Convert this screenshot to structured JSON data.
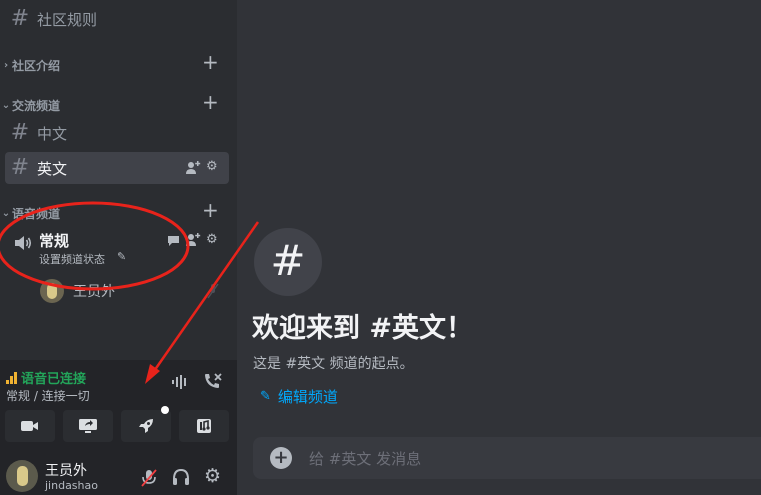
{
  "sidebar": {
    "top_channel": "社区规则",
    "categories": {
      "intro": "社区介绍",
      "text": "交流频道",
      "voice": "语音频道"
    },
    "channels": [
      "中文",
      "英文"
    ],
    "voice_channel": {
      "name": "常规",
      "status": "设置频道状态",
      "member": "王员外"
    }
  },
  "voice_panel": {
    "connected": "语音已连接",
    "location": "常规 / 连接一切"
  },
  "user_panel": {
    "name": "王员外",
    "handle": "jindashao"
  },
  "main": {
    "welcome": "欢迎来到 #英文！",
    "start_text": "这是 #英文 频道的起点。",
    "edit_channel": "编辑频道",
    "composer_placeholder": "给 #英文 发消息"
  },
  "colors": {
    "accent_link": "#00a8fc",
    "connected_green": "#23a55a",
    "annotation_red": "#e8231b"
  },
  "icons": [
    "hash-icon",
    "plus-icon",
    "speaker-icon",
    "gear-icon",
    "add-member-icon",
    "chat-icon",
    "pencil-icon",
    "signal-icon",
    "soundwave-icon",
    "hangup-icon",
    "camera-icon",
    "screenshare-icon",
    "rocket-icon",
    "soundboard-icon",
    "mute-icon",
    "headphones-icon",
    "add-circle-icon"
  ]
}
